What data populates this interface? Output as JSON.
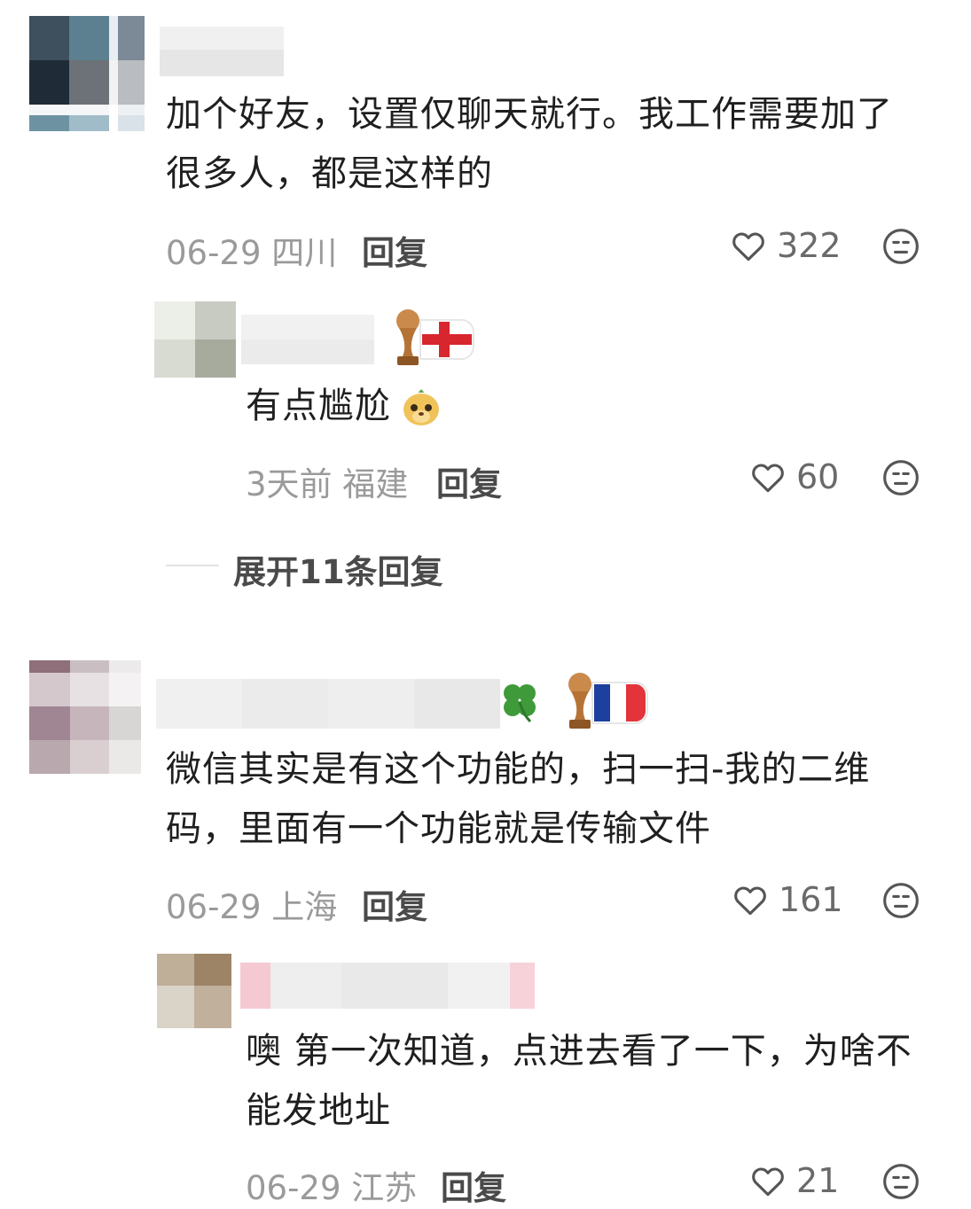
{
  "comments": [
    {
      "text_line1": "加个好友，设置仅聊天就行。我工作需要加了",
      "text_line2": "很多人，都是这样的",
      "date_location": "06-29 四川",
      "reply_label": "回复",
      "likes": "322",
      "reply": {
        "text": "有点尴尬",
        "date_location": "3天前 福建",
        "reply_label": "回复",
        "likes": "60"
      },
      "expand_label": "展开11条回复"
    },
    {
      "text_line1": "微信其实是有这个功能的，扫一扫-我的二维",
      "text_line2": "码，里面有一个功能就是传输文件",
      "date_location": "06-29 上海",
      "reply_label": "回复",
      "likes": "161",
      "reply": {
        "text_line1": "噢 第一次知道，点进去看了一下，为啥不",
        "text_line2": "能发地址",
        "date_location": "06-29 江苏",
        "reply_label": "回复",
        "likes": "21"
      }
    }
  ],
  "icons": {
    "like": "heart-outline-icon",
    "dislike": "unhappy-face-icon",
    "clover": "four-leaf-clover-icon",
    "flag_england": "england-flag-icon",
    "flag_france": "france-flag-icon",
    "trophy": "world-cup-trophy-icon",
    "emoji": "meerkat-emoji-icon"
  },
  "colors": {
    "text": "#1f1f1f",
    "meta": "#9a9a9a",
    "reply": "#4a4a4a",
    "england_red": "#d8262f",
    "france_blue": "#1d3f9e",
    "france_red": "#e2343a",
    "clover_green": "#3f9a3a"
  }
}
